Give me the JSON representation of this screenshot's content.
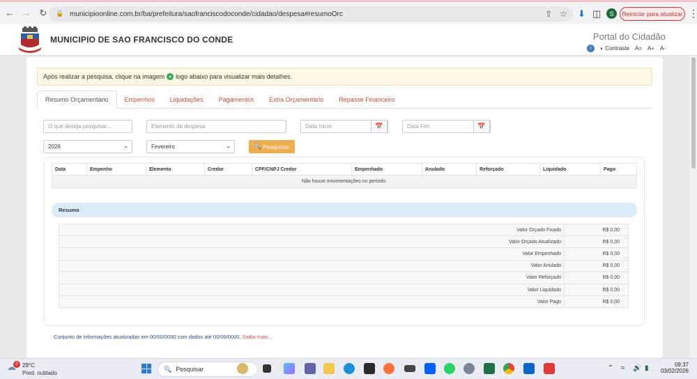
{
  "browser": {
    "url": "municipioonline.com.br/ba/prefeitura/saofranciscodoconde/cidadao/despesa#resumoOrc",
    "profile_initial": "S",
    "restart_label": "Reiniciar para atualizar"
  },
  "header": {
    "title": "MUNICIPIO DE SAO FRANCISCO DO CONDE",
    "portal": "Portal do Cidadão",
    "info_glyph": "i",
    "contrast_label": "Contraste",
    "font_reset": "A=",
    "font_plus": "A+",
    "font_minus": "A-"
  },
  "notice": {
    "before": "Após realizar a pesquisa, clique na imagem",
    "after": "logo abaixo para visualizar mais detalhes."
  },
  "tabs": [
    {
      "label": "Resumo Orçamentário",
      "active": true
    },
    {
      "label": "Empenhos"
    },
    {
      "label": "Liquidações"
    },
    {
      "label": "Pagamentos"
    },
    {
      "label": "Extra Orçamentário"
    },
    {
      "label": "Repasse Financeiro"
    }
  ],
  "filters": {
    "search_placeholder": "O que deseja pesquisar...",
    "element_placeholder": "Elemento de despesa",
    "start_placeholder": "Data Inicio",
    "end_placeholder": "Data Fim",
    "year": "2026",
    "month": "Fevereiro",
    "search_button": "Pesquisar"
  },
  "movements": {
    "columns": [
      "Data",
      "Empenho",
      "Elemento",
      "Credor",
      "CPF/CNPJ Credor",
      "Empenhado",
      "Anulado",
      "Reforçado",
      "Liquidado",
      "Pago"
    ],
    "empty_message": "Não houve movimentações no período."
  },
  "resumo": {
    "title": "Resumo",
    "rows": [
      {
        "label": "Valor Orçado Fixado",
        "value": "R$ 0,00"
      },
      {
        "label": "Valor Orçado Atualizado",
        "value": "R$ 0,00"
      },
      {
        "label": "Valor Empenhado",
        "value": "R$ 0,00"
      },
      {
        "label": "Valor Anulado",
        "value": "R$ 0,00"
      },
      {
        "label": "Valor Reforçado",
        "value": "R$ 0,00"
      },
      {
        "label": "Valor Liquidado",
        "value": "R$ 0,00"
      },
      {
        "label": "Valor Pago",
        "value": "R$ 0,00"
      }
    ]
  },
  "footer": {
    "text": "Conjunto de informações atualizadas em 00/00/0000 com dados até 00/00/0000.",
    "more": "Saiba mais..."
  },
  "taskbar": {
    "notification_count": "2",
    "temperature": "29°C",
    "condition": "Pred. nublado",
    "search_label": "Pesquisar",
    "time": "09:37",
    "date": "03/02/2026"
  }
}
